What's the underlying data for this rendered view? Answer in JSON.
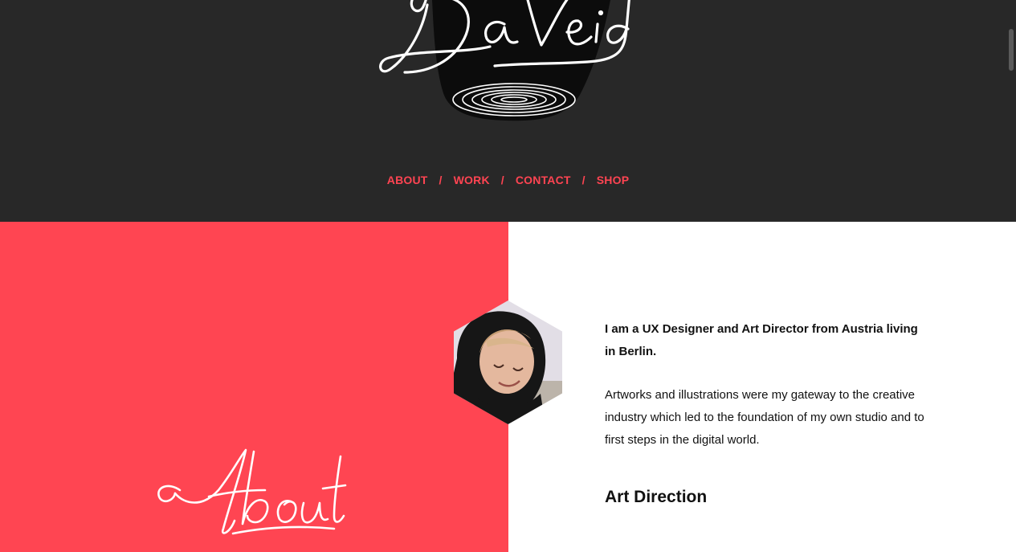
{
  "brand": {
    "logo_text": "DaVeid"
  },
  "nav": {
    "items": [
      {
        "label": "ABOUT"
      },
      {
        "label": "WORK"
      },
      {
        "label": "CONTACT"
      },
      {
        "label": "SHOP"
      }
    ],
    "separator": "/"
  },
  "about": {
    "script_heading": "About",
    "intro_bold": "I am a UX Designer and Art Director from Austria living in Berlin.",
    "intro_body": "Artworks and illustrations were my gateway to the creative industry which led to the foundation of my own studio and to first steps in the digital world.",
    "section_heading": "Art Direction"
  },
  "colors": {
    "header_bg": "#282828",
    "accent": "#ff4552",
    "text": "#111111"
  }
}
